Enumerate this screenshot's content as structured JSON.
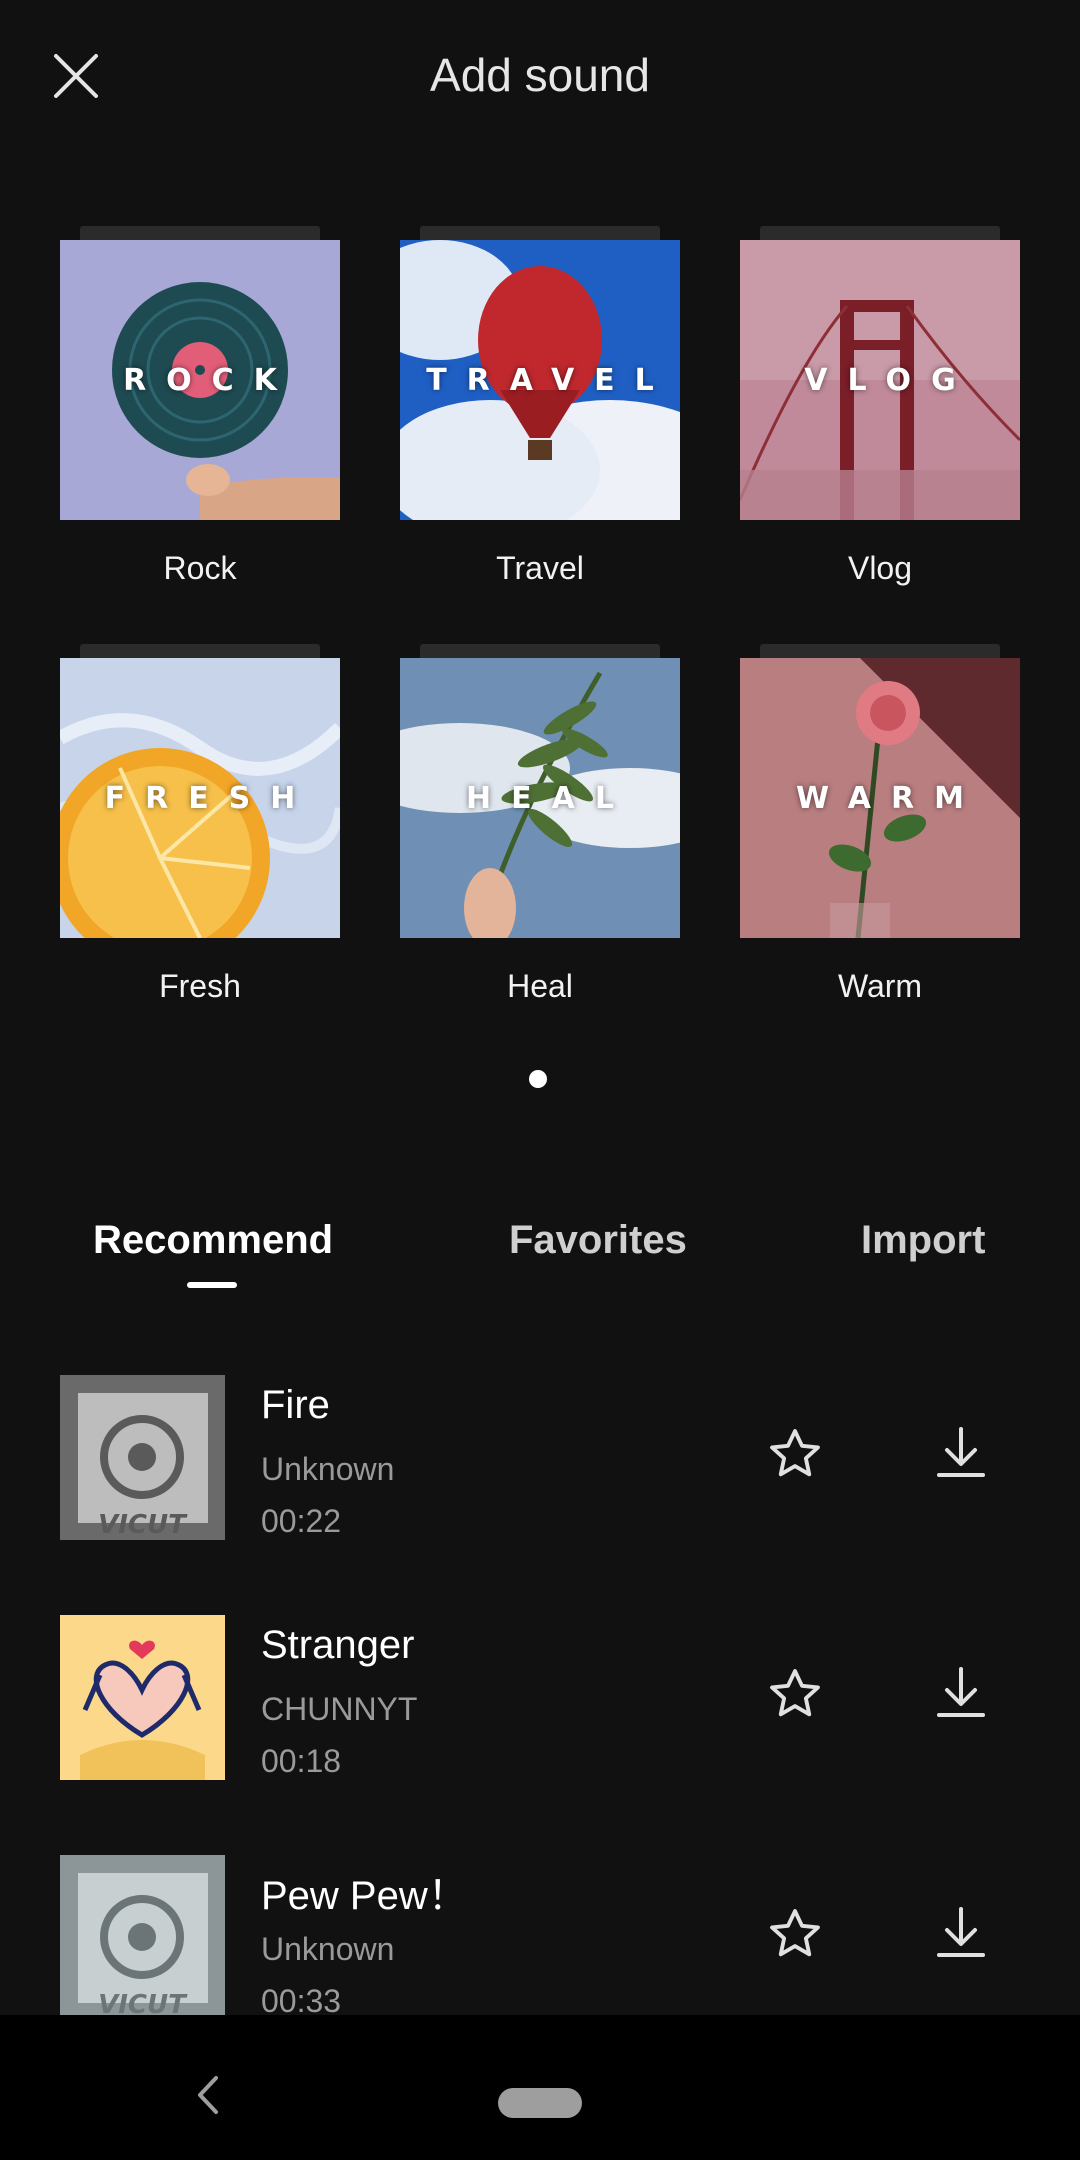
{
  "header": {
    "title": "Add sound",
    "close_icon": "close-icon"
  },
  "categories": [
    {
      "label": "Rock",
      "overlay": "ROCK"
    },
    {
      "label": "Travel",
      "overlay": "TRAVEL"
    },
    {
      "label": "Vlog",
      "overlay": "VLOG"
    },
    {
      "label": "Fresh",
      "overlay": "FRESH"
    },
    {
      "label": "Heal",
      "overlay": "HEAL"
    },
    {
      "label": "Warm",
      "overlay": "WARM"
    }
  ],
  "pager": {
    "pages": 1,
    "active": 1
  },
  "tabs": [
    {
      "label": "Recommend",
      "active": true
    },
    {
      "label": "Favorites",
      "active": false
    },
    {
      "label": "Import",
      "active": false
    }
  ],
  "songs": [
    {
      "title": "Fire",
      "artist": "Unknown",
      "duration": "00:22",
      "cover_logo": "VICUT"
    },
    {
      "title": "Stranger",
      "artist": "CHUNNYT",
      "duration": "00:18",
      "cover_logo": ""
    },
    {
      "title": "Pew Pew！",
      "artist": "Unknown",
      "duration": "00:33",
      "cover_logo": "VICUT"
    }
  ],
  "icons": {
    "favorite": "star-outline-icon",
    "download": "download-icon",
    "back": "back-chevron-icon"
  },
  "colors": {
    "background": "#111111",
    "text": "#ffffff",
    "secondary_text": "#9a9a9a",
    "nav_bar": "#000000"
  }
}
